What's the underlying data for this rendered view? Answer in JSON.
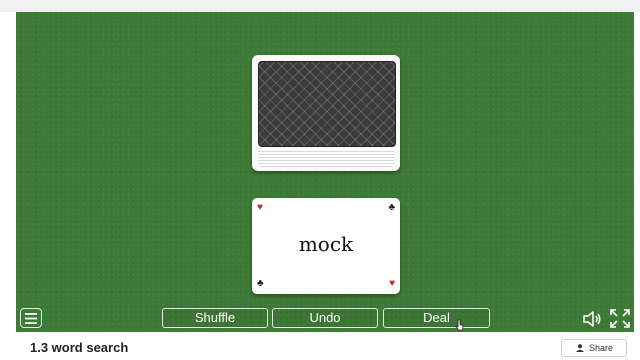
{
  "game": {
    "card_word": "mock",
    "buttons": {
      "shuffle": "Shuffle",
      "undo": "Undo",
      "deal": "Deal"
    }
  },
  "icons": {
    "menu": "hamburger-menu-icon",
    "sound": "speaker-icon",
    "fullscreen": "expand-icon",
    "share": "person-icon",
    "suits": [
      "heart",
      "club",
      "club",
      "heart"
    ]
  },
  "footer": {
    "title": "1.3 word search",
    "share_label": "Share"
  },
  "colors": {
    "table_green": "#3e7a37",
    "card_back": "#3b3b3b",
    "suit_red": "#c62828"
  }
}
